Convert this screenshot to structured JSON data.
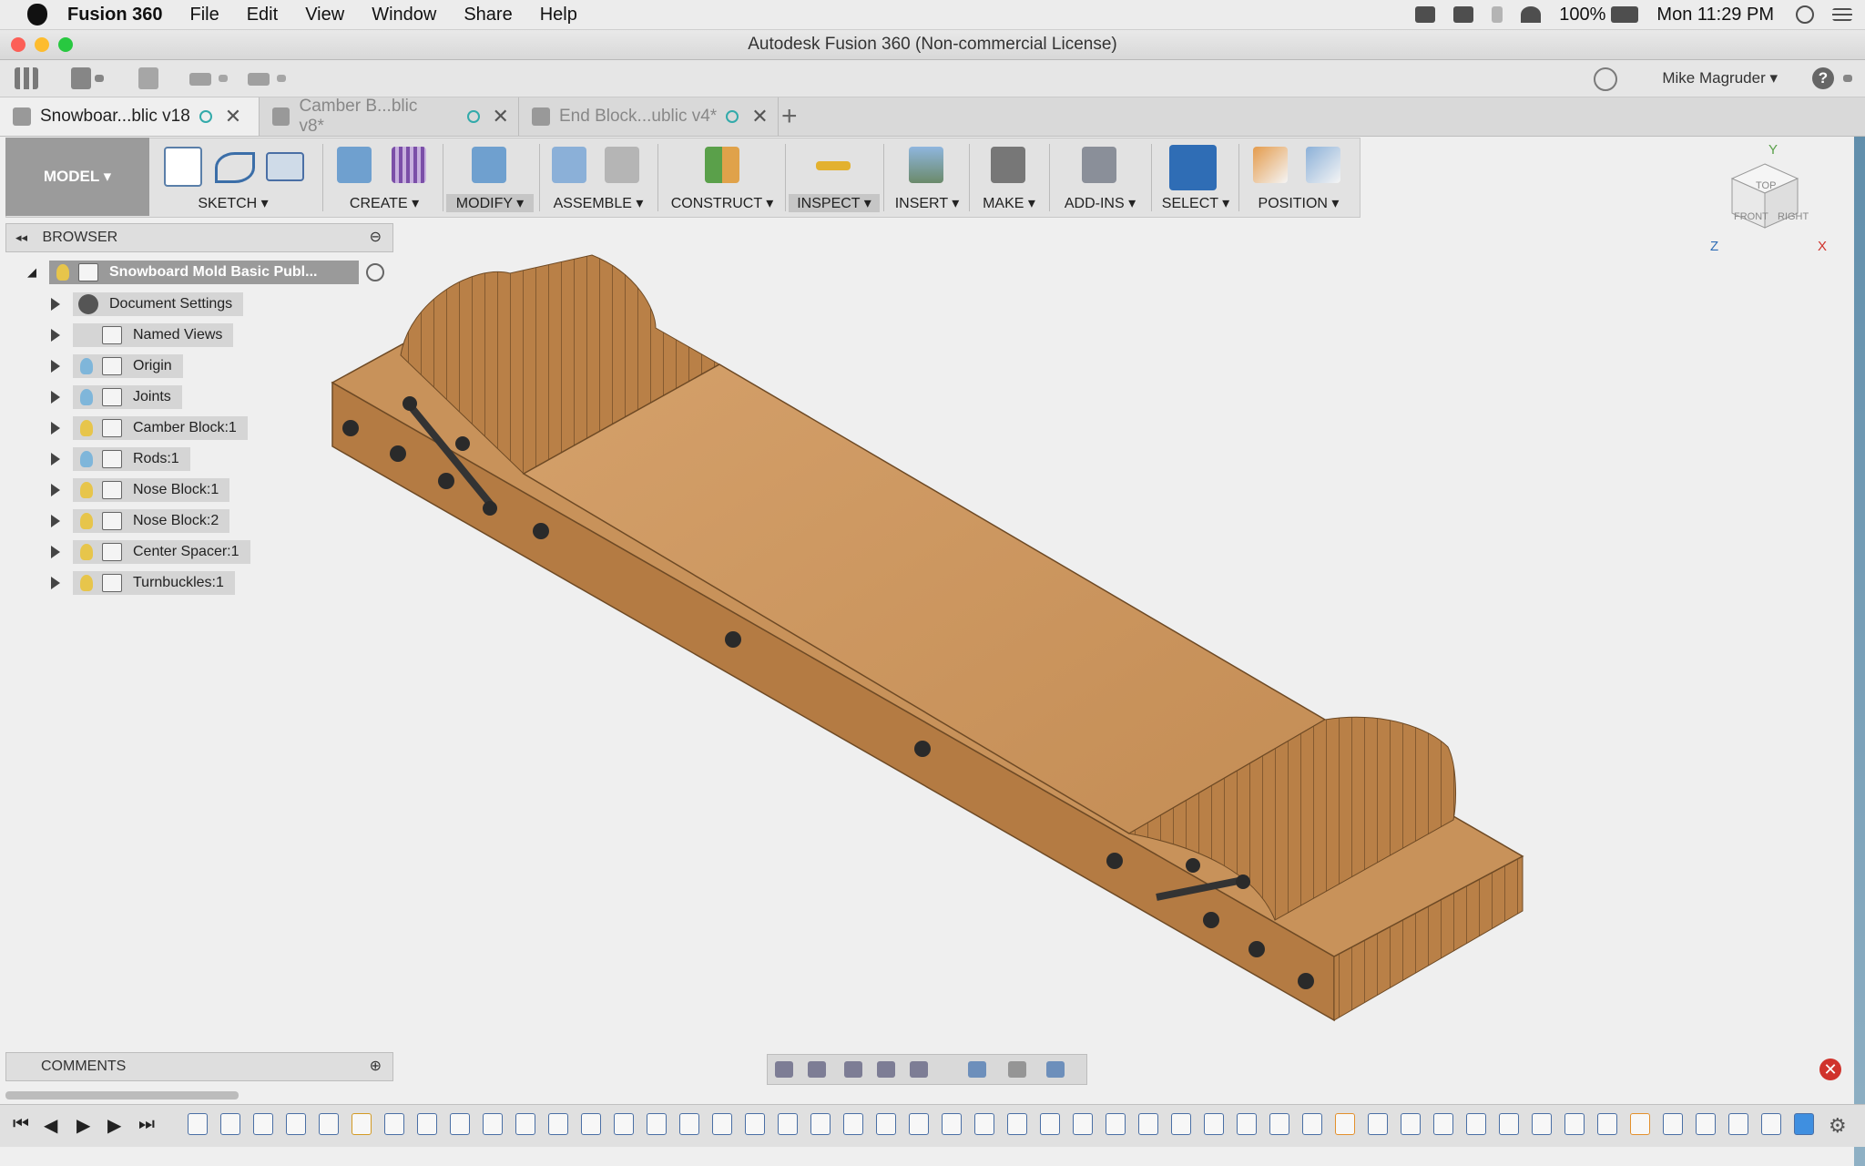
{
  "menubar": {
    "app_name": "Fusion 360",
    "items": [
      "File",
      "Edit",
      "View",
      "Window",
      "Share",
      "Help"
    ],
    "battery": "100%",
    "clock": "Mon 11:29 PM"
  },
  "window": {
    "title": "Autodesk Fusion 360 (Non-commercial License)"
  },
  "toolbar": {
    "user": "Mike Magruder ▾",
    "help": "?"
  },
  "tabs": [
    {
      "label": "Snowboar...blic v18"
    },
    {
      "label": "Camber B...blic v8*"
    },
    {
      "label": "End Block...ublic v4*"
    }
  ],
  "ribbon": {
    "workspace": "MODEL ▾",
    "groups": [
      "SKETCH ▾",
      "CREATE ▾",
      "MODIFY ▾",
      "ASSEMBLE ▾",
      "CONSTRUCT ▾",
      "INSPECT ▾",
      "INSERT ▾",
      "MAKE ▾",
      "ADD-INS ▾",
      "SELECT ▾",
      "POSITION ▾"
    ]
  },
  "viewcube": {
    "top": "TOP",
    "front": "FRONT",
    "right": "RIGHT",
    "x": "X",
    "y": "Y",
    "z": "Z"
  },
  "browser": {
    "title": "BROWSER",
    "root": "Snowboard Mold Basic Publ...",
    "nodes": [
      {
        "label": "Document Settings",
        "icon": "gear-icon"
      },
      {
        "label": "Named Views",
        "icon": "folder-icon"
      },
      {
        "label": "Origin",
        "icon": "folder-icon"
      },
      {
        "label": "Joints",
        "icon": "folder-icon"
      },
      {
        "label": "Camber Block:1",
        "icon": "component-icon"
      },
      {
        "label": "Rods:1",
        "icon": "component-icon"
      },
      {
        "label": "Nose Block:1",
        "icon": "component-icon"
      },
      {
        "label": "Nose Block:2",
        "icon": "component-icon"
      },
      {
        "label": "Center Spacer:1",
        "icon": "component-icon"
      },
      {
        "label": "Turnbuckles:1",
        "icon": "component-icon"
      }
    ]
  },
  "comments": {
    "title": "COMMENTS"
  },
  "colors": {
    "wood": "#c9955e",
    "wood_dark": "#a8743f",
    "accent": "#2f6db5",
    "error": "#d0332c"
  }
}
